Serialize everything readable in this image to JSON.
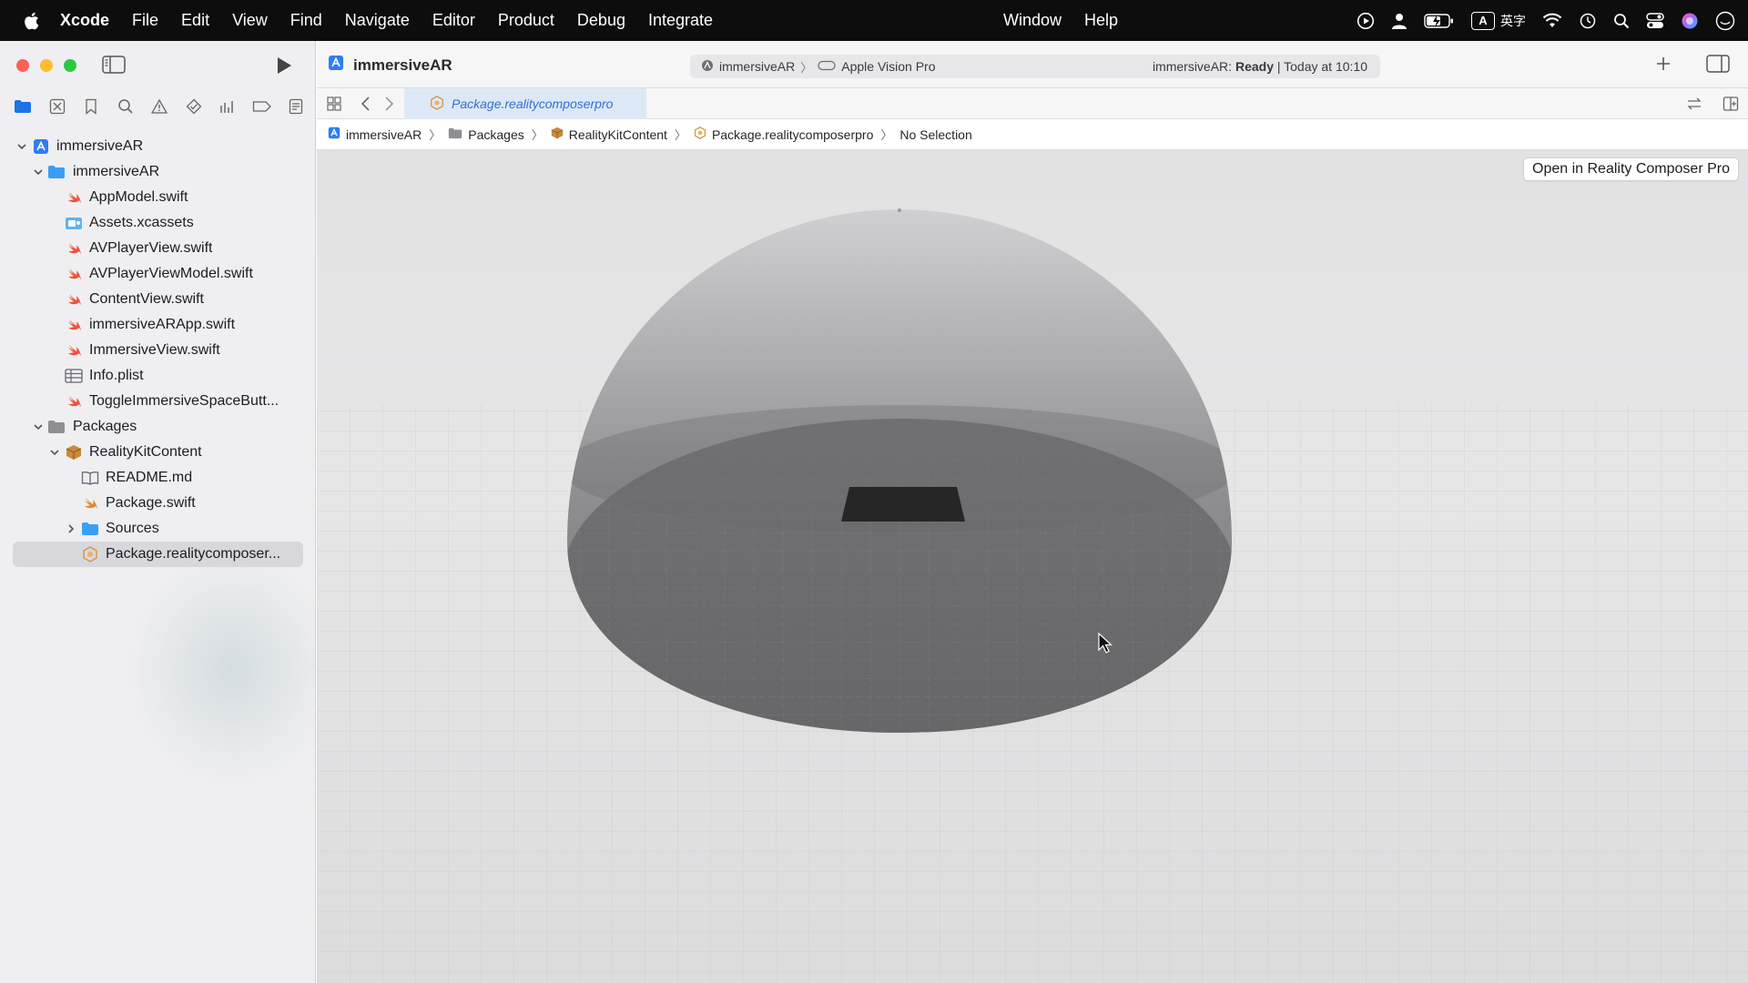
{
  "menubar": {
    "app_name": "Xcode",
    "menus": [
      "File",
      "Edit",
      "View",
      "Find",
      "Navigate",
      "Editor",
      "Product",
      "Debug",
      "Integrate"
    ],
    "right_menus": [
      "Window",
      "Help"
    ],
    "status_icons": [
      "play-circle-icon",
      "person-icon",
      "battery-icon",
      "input-method-icon",
      "wifi-icon",
      "time-machine-icon",
      "spotlight-icon",
      "control-center-icon",
      "siri-icon",
      "user-icon"
    ],
    "ime_label": "A",
    "ime_text": "英字"
  },
  "window": {
    "project_title": "immersiveAR",
    "scheme": "immersiveAR",
    "destination": "Apple Vision Pro",
    "status_prefix": "immersiveAR: ",
    "status_state": "Ready",
    "status_suffix": " | Today at 10:10",
    "tab_label": "Package.realitycomposerpro",
    "open_button": "Open in Reality Composer Pro"
  },
  "navigator": {
    "items": [
      {
        "label": "immersiveAR",
        "icon": "xcode-project-icon",
        "level": 0,
        "chevron": "down"
      },
      {
        "label": "immersiveAR",
        "icon": "folder-icon",
        "level": 1,
        "chevron": "down"
      },
      {
        "label": "AppModel.swift",
        "icon": "swift-file-icon",
        "level": 2
      },
      {
        "label": "Assets.xcassets",
        "icon": "asset-catalog-icon",
        "level": 2
      },
      {
        "label": "AVPlayerView.swift",
        "icon": "swift-file-icon",
        "level": 2
      },
      {
        "label": "AVPlayerViewModel.swift",
        "icon": "swift-file-icon",
        "level": 2
      },
      {
        "label": "ContentView.swift",
        "icon": "swift-file-icon",
        "level": 2
      },
      {
        "label": "immersiveARApp.swift",
        "icon": "swift-file-icon",
        "level": 2
      },
      {
        "label": "ImmersiveView.swift",
        "icon": "swift-file-icon",
        "level": 2
      },
      {
        "label": "Info.plist",
        "icon": "plist-icon",
        "level": 2
      },
      {
        "label": "ToggleImmersiveSpaceButt...",
        "icon": "swift-file-icon",
        "level": 2
      },
      {
        "label": "Packages",
        "icon": "folder-gray-icon",
        "level": 1,
        "chevron": "down"
      },
      {
        "label": "RealityKitContent",
        "icon": "package-icon",
        "level": 2,
        "chevron": "down"
      },
      {
        "label": "README.md",
        "icon": "book-icon",
        "level": 3
      },
      {
        "label": "Package.swift",
        "icon": "swift-package-icon",
        "level": 3
      },
      {
        "label": "Sources",
        "icon": "folder-icon",
        "level": 3,
        "chevron": "right"
      },
      {
        "label": "Package.realitycomposer...",
        "icon": "reality-composer-icon",
        "level": 3,
        "selected": true
      }
    ]
  },
  "breadcrumb": [
    {
      "label": "immersiveAR",
      "icon": "xcode-project-icon"
    },
    {
      "label": "Packages",
      "icon": "folder-gray-icon"
    },
    {
      "label": "RealityKitContent",
      "icon": "package-icon"
    },
    {
      "label": "Package.realitycomposerpro",
      "icon": "reality-composer-icon"
    },
    {
      "label": "No Selection",
      "icon": ""
    }
  ],
  "colors": {
    "accent": "#2f6fd1",
    "swift": "#f05138",
    "folder": "#3b9ef5",
    "package": "#c98a3a"
  }
}
